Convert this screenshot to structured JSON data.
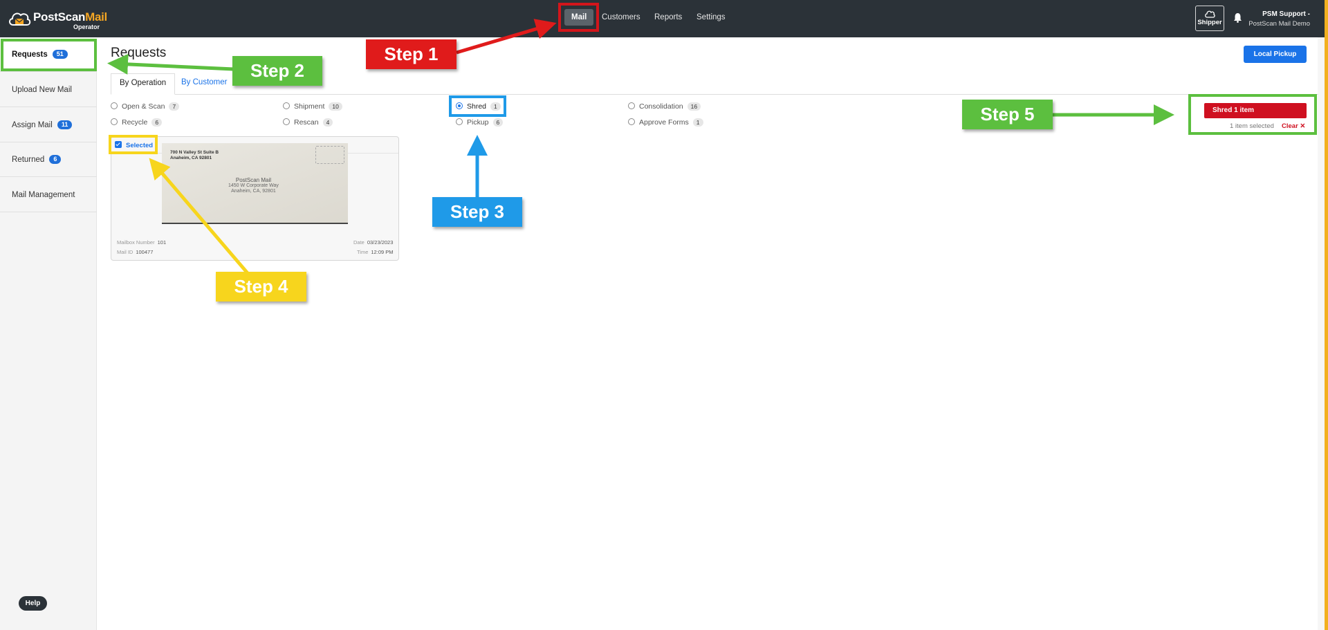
{
  "app": {
    "logo_main": "PostScan",
    "logo_accent": "Mail",
    "logo_sub": "Operator"
  },
  "nav": {
    "items": [
      {
        "label": "Mail",
        "active": true
      },
      {
        "label": "Customers",
        "active": false
      },
      {
        "label": "Reports",
        "active": false
      },
      {
        "label": "Settings",
        "active": false
      }
    ]
  },
  "header": {
    "shipper_label": "Shipper",
    "user_name": "PSM Support -",
    "user_org": "PostScan Mail Demo"
  },
  "sidebar": {
    "items": [
      {
        "label": "Requests",
        "badge": "51",
        "active": true
      },
      {
        "label": "Upload New Mail",
        "badge": null
      },
      {
        "label": "Assign Mail",
        "badge": "11"
      },
      {
        "label": "Returned",
        "badge": "6"
      },
      {
        "label": "Mail Management",
        "badge": null
      }
    ],
    "help_label": "Help"
  },
  "main": {
    "title": "Requests",
    "local_pickup_label": "Local Pickup",
    "tabs": [
      {
        "label": "By Operation",
        "active": true
      },
      {
        "label": "By Customer",
        "active": false
      }
    ],
    "operations": [
      {
        "label": "Open & Scan",
        "count": "7",
        "selected": false
      },
      {
        "label": "Shipment",
        "count": "10",
        "selected": false
      },
      {
        "label": "Shred",
        "count": "1",
        "selected": true
      },
      {
        "label": "Consolidation",
        "count": "16",
        "selected": false
      },
      {
        "label": "Recycle",
        "count": "6",
        "selected": false
      },
      {
        "label": "Rescan",
        "count": "4",
        "selected": false
      },
      {
        "label": "Pickup",
        "count": "6",
        "selected": false
      },
      {
        "label": "Approve Forms",
        "count": "1",
        "selected": false
      }
    ],
    "action": {
      "button_label": "Shred 1 item",
      "selected_info": "1 item selected",
      "clear_label": "Clear"
    },
    "card": {
      "selected_label": "Selected",
      "envelope_from": [
        "700 N Valley St Suite B",
        "Anaheim, CA 92801"
      ],
      "envelope_to": [
        "PostScan Mail",
        "1450 W Corporate Way",
        "Anaheim, CA, 92801"
      ],
      "mailbox_label": "Mailbox Number",
      "mailbox_value": "101",
      "mailid_label": "Mail ID",
      "mailid_value": "100477",
      "date_label": "Date",
      "date_value": "03/23/2023",
      "time_label": "Time",
      "time_value": "12:09 PM"
    }
  },
  "annotations": {
    "step1": "Step 1",
    "step2": "Step 2",
    "step3": "Step 3",
    "step4": "Step 4",
    "step5": "Step 5",
    "colors": {
      "red": "#e01b1b",
      "green": "#5cbf3f",
      "blue": "#1f9ae8",
      "yellow": "#f7d51d"
    }
  }
}
